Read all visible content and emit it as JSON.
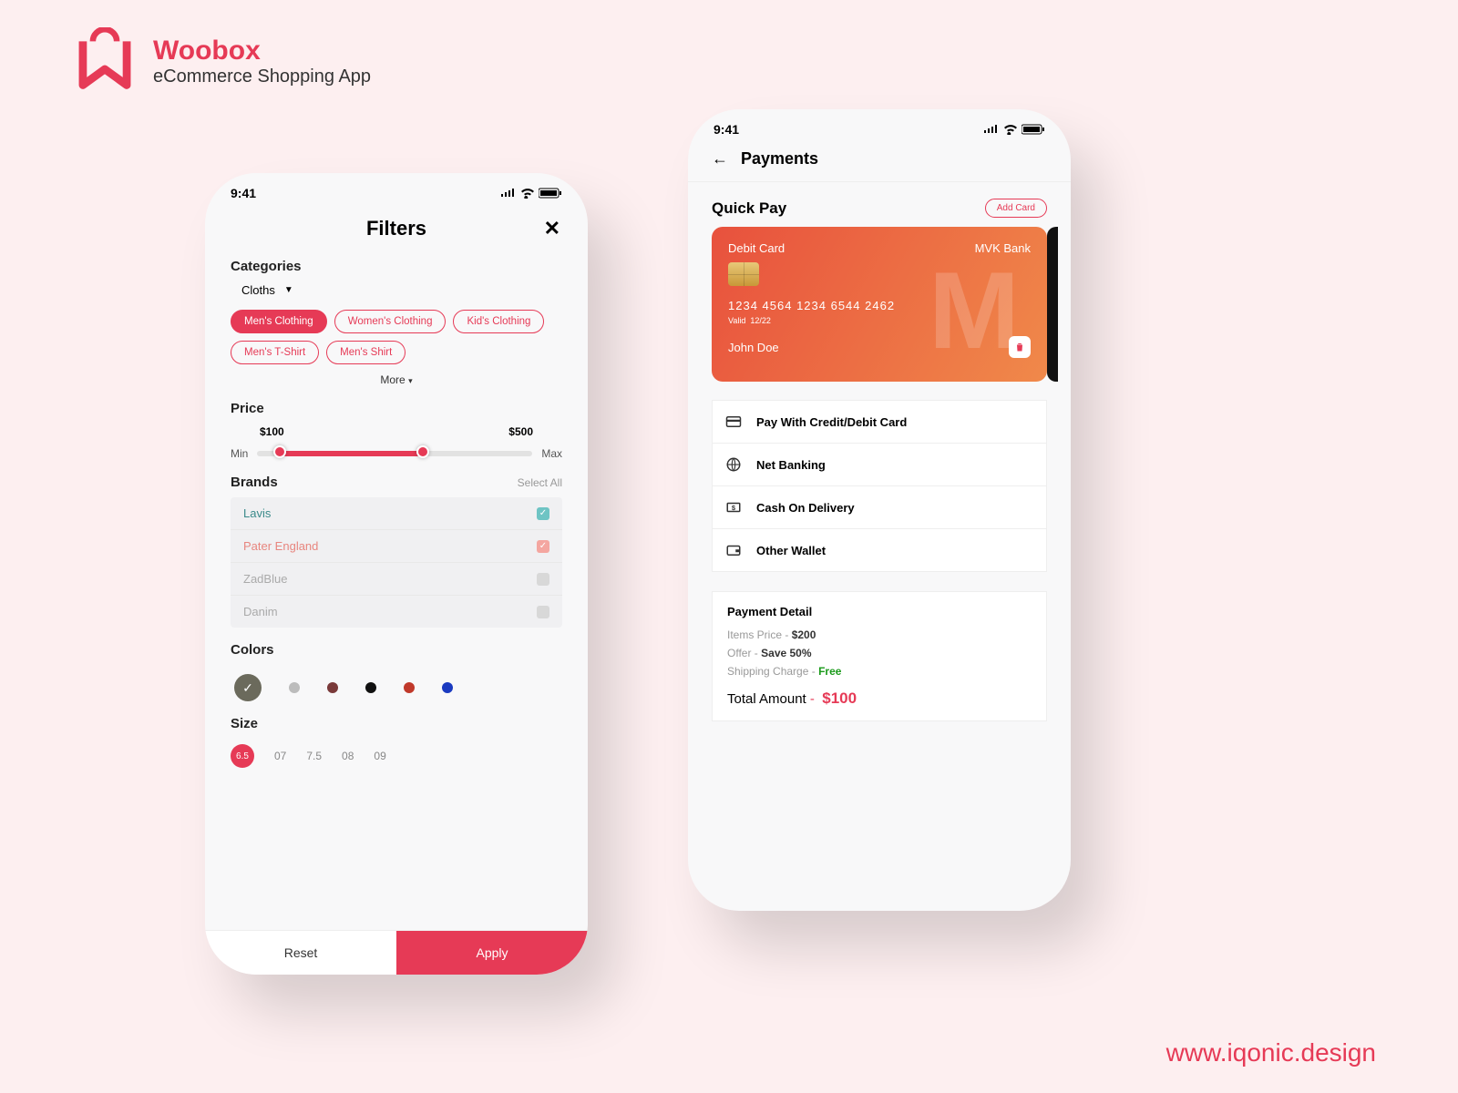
{
  "brand": {
    "name": "Woobox",
    "tagline": "eCommerce Shopping App"
  },
  "footer_url": "www.iqonic.design",
  "status_time": "9:41",
  "filters": {
    "title": "Filters",
    "categories_label": "Categories",
    "dropdown_value": "Cloths",
    "chips": [
      "Men's Clothing",
      "Women's Clothing",
      "Kid's Clothing",
      "Men's T-Shirt",
      "Men's Shirt"
    ],
    "more_label": "More",
    "price_label": "Price",
    "price_min_val": "$100",
    "price_max_val": "$500",
    "min_label": "Min",
    "max_label": "Max",
    "brands_label": "Brands",
    "select_all": "Select All",
    "brands": [
      {
        "name": "Lavis",
        "checked": true
      },
      {
        "name": "Pater England",
        "checked": true
      },
      {
        "name": "ZadBlue",
        "checked": false
      },
      {
        "name": "Danim",
        "checked": false
      }
    ],
    "colors_label": "Colors",
    "color_swatches": [
      "#6b6a5c",
      "#bcbcbc",
      "#7a3a3a",
      "#111111",
      "#c0392b",
      "#1a3ac0"
    ],
    "size_label": "Size",
    "sizes": [
      "6.5",
      "07",
      "7.5",
      "08",
      "09"
    ],
    "reset": "Reset",
    "apply": "Apply"
  },
  "payments": {
    "title": "Payments",
    "quick_pay": "Quick Pay",
    "add_card": "Add Card",
    "card": {
      "type": "Debit Card",
      "bank": "MVK Bank",
      "number": "1234   4564   1234   6544   2462",
      "valid_label": "Valid",
      "valid": "12/22",
      "holder": "John Doe"
    },
    "options": [
      "Pay With Credit/Debit Card",
      "Net Banking",
      "Cash On Delivery",
      "Other Wallet"
    ],
    "detail_title": "Payment Detail",
    "items_price_label": "Items Price -",
    "items_price": "$200",
    "offer_label": "Offer -",
    "offer": "Save 50%",
    "shipping_label": "Shipping Charge -",
    "shipping": "Free",
    "total_label": "Total Amount",
    "total": "$100"
  }
}
